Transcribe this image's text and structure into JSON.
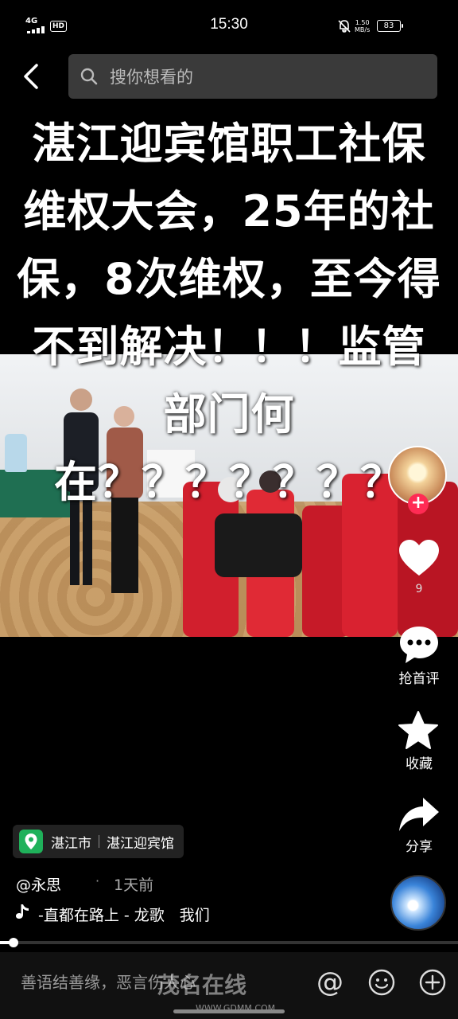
{
  "status_bar": {
    "network": "4G",
    "hd": "HD",
    "time": "15:30",
    "speed_value": "1.50",
    "speed_unit": "MB/s",
    "battery": "83"
  },
  "search": {
    "placeholder": "搜你想看的"
  },
  "caption": "湛江迎宾馆职工社保维权大会，25年的社保，8次维权，至今得不到解决！！！监管部门何在？？？？？？？",
  "rail": {
    "like_count": "9",
    "comment_label": "抢首评",
    "favorite_label": "收藏",
    "share_label": "分享"
  },
  "location": {
    "city": "湛江市",
    "place": "湛江迎宾馆"
  },
  "author": "@永思",
  "separator": "·",
  "time_ago": "1天前",
  "music": "-直都在路上 - 龙歌　我们",
  "progress": 0.03,
  "comment_bar": {
    "placeholder": "善语结善缘，恶言伤人心"
  },
  "watermark": {
    "title": "茂名在线",
    "url": "WWW.GDMM.COM"
  }
}
